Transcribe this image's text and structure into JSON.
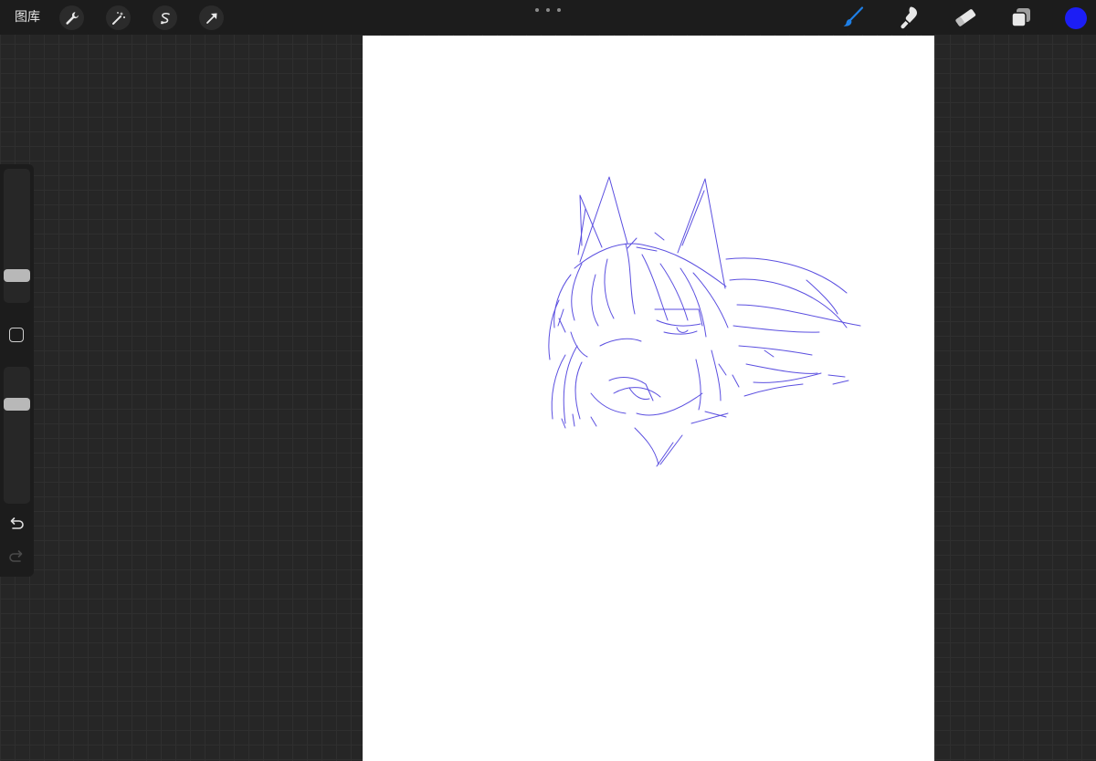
{
  "topbar": {
    "gallery_label": "图库",
    "left_tools": [
      "wrench-icon",
      "magic-wand-icon",
      "selection-icon",
      "transform-arrow-icon"
    ],
    "more_icon": "more-dots-icon",
    "right_tools": [
      "brush-icon",
      "smudge-icon",
      "eraser-icon",
      "layers-icon"
    ],
    "active_tool": "brush",
    "colors": {
      "active_tool": "#1e7fe6",
      "inactive_tool": "#e8e8e8",
      "current_color": "#1c1ef5"
    }
  },
  "sidebar": {
    "brush_size": 0.17,
    "brush_opacity": 0.75,
    "modify_icon": "modify-square-icon",
    "undo_icon": "undo-icon",
    "redo_icon": "redo-icon"
  },
  "canvas": {
    "background": "#ffffff",
    "stroke_color": "#5b4fe0"
  }
}
